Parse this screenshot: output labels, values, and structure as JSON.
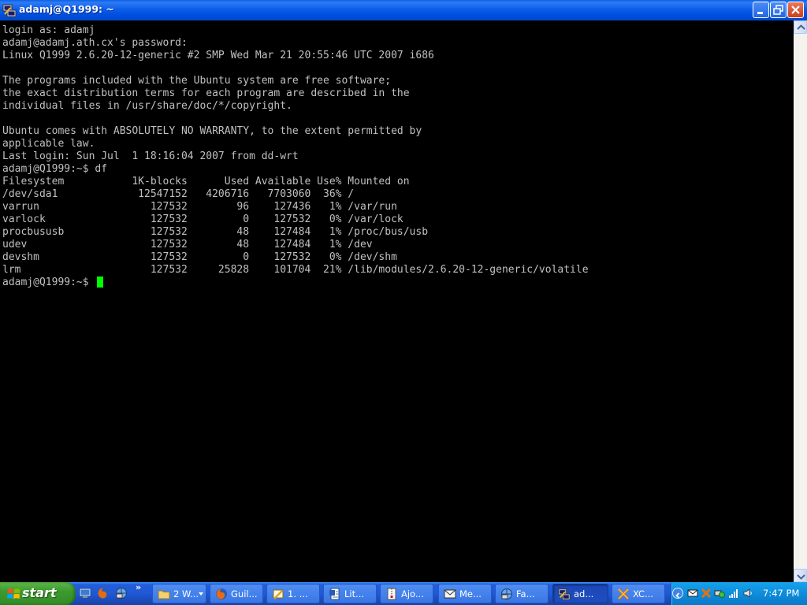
{
  "window": {
    "title": "adamj@Q1999: ~"
  },
  "terminal": {
    "lines": [
      "login as: adamj",
      "adamj@adamj.ath.cx's password:",
      "Linux Q1999 2.6.20-12-generic #2 SMP Wed Mar 21 20:55:46 UTC 2007 i686",
      "",
      "The programs included with the Ubuntu system are free software;",
      "the exact distribution terms for each program are described in the",
      "individual files in /usr/share/doc/*/copyright.",
      "",
      "Ubuntu comes with ABSOLUTELY NO WARRANTY, to the extent permitted by",
      "applicable law.",
      "Last login: Sun Jul  1 18:16:04 2007 from dd-wrt",
      "adamj@Q1999:~$ df",
      "Filesystem           1K-blocks      Used Available Use% Mounted on",
      "/dev/sda1             12547152   4206716   7703060  36% /",
      "varrun                  127532        96    127436   1% /var/run",
      "varlock                 127532         0    127532   0% /var/lock",
      "procbususb              127532        48    127484   1% /proc/bus/usb",
      "udev                    127532        48    127484   1% /dev",
      "devshm                  127532         0    127532   0% /dev/shm",
      "lrm                     127532     25828    101704  21% /lib/modules/2.6.20-12-generic/volatile",
      "adamj@Q1999:~$ "
    ],
    "cursor_color": "#00ff00",
    "text_color": "#c0c0c0",
    "background": "#000000"
  },
  "taskbar": {
    "start_label": "start",
    "quick_launch_icons": [
      "show-desktop-icon",
      "firefox-icon",
      "network-icon"
    ],
    "quick_launch_more": "»",
    "tasks": [
      {
        "label": "2 W...",
        "icon": "folder-icon",
        "grouped": true
      },
      {
        "label": "Guil...",
        "icon": "firefox-icon"
      },
      {
        "label": "1. ...",
        "icon": "pencil-icon"
      },
      {
        "label": "Lit...",
        "icon": "document-icon"
      },
      {
        "label": "Ajo...",
        "icon": "zip-icon"
      },
      {
        "label": "Me...",
        "icon": "mail-icon"
      },
      {
        "label": "Fa...",
        "icon": "network-icon"
      },
      {
        "label": "ad...",
        "icon": "putty-icon",
        "active": true
      },
      {
        "label": "XC...",
        "icon": "xchat-icon"
      }
    ],
    "tray_icons": [
      "mail-tray-icon",
      "xchat-tray-icon",
      "network-tray-icon",
      "signal-icon",
      "volume-icon"
    ],
    "clock": "7:47 PM"
  },
  "colors": {
    "titlebar_blue": "#0050e0",
    "start_green": "#3c9a2e",
    "taskbar_blue": "#245edb",
    "tray_blue": "#0e8ddb"
  }
}
